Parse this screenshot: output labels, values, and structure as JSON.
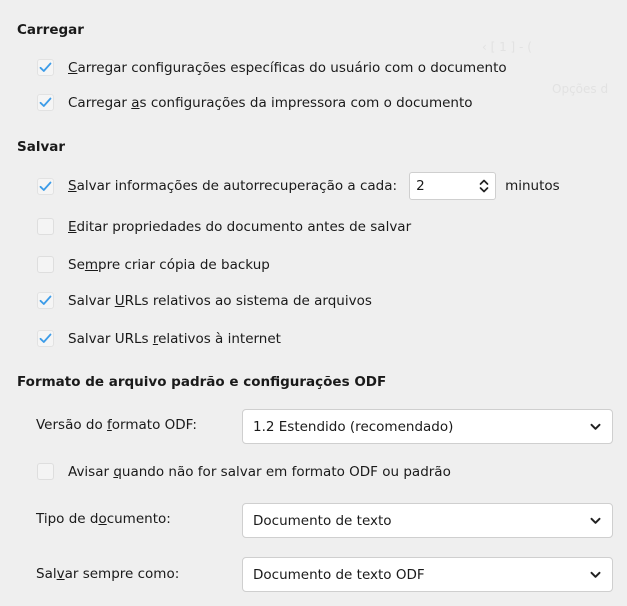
{
  "background_ghost": {
    "line1": "‹  [ 1 ] - (",
    "line2": "Opções d"
  },
  "load": {
    "title": "Carregar",
    "options": [
      {
        "pre": "",
        "key": "C",
        "post": "arregar configurações específicas do usuário com o documento",
        "checked": true
      },
      {
        "pre": "Carregar ",
        "key": "a",
        "post": "s configurações da impressora com o documento",
        "checked": true
      }
    ]
  },
  "save": {
    "title": "Salvar",
    "autosave": {
      "pre": "",
      "key": "S",
      "post": "alvar informações de autorrecuperação a cada:",
      "checked": true,
      "value": "2",
      "unit": "minutos"
    },
    "options": [
      {
        "pre": "",
        "key": "E",
        "post": "ditar propriedades do documento antes de salvar",
        "checked": false
      },
      {
        "pre": "Se",
        "key": "m",
        "post": "pre criar cópia de backup",
        "checked": false
      },
      {
        "pre": "Salvar ",
        "key": "U",
        "post": "RLs relativos ao sistema de arquivos",
        "checked": true
      },
      {
        "pre": "Salvar URLs ",
        "key": "r",
        "post": "elativos à internet",
        "checked": true
      }
    ]
  },
  "odf": {
    "title": "Formato de arquivo padrão e configurações ODF",
    "version": {
      "label_pre": "Versão do ",
      "label_key": "f",
      "label_post": "ormato ODF:",
      "value": "1.2 Estendido (recomendado)"
    },
    "warn": {
      "pre": "Avisar ",
      "key": "q",
      "post": "uando não for salvar em formato ODF ou padrão",
      "checked": false
    },
    "doc_type": {
      "label_pre": "Tipo de d",
      "label_key": "o",
      "label_post": "cumento:",
      "value": "Documento de texto"
    },
    "always_save": {
      "label_pre": "Sal",
      "label_key": "v",
      "label_post": "ar sempre como:",
      "value": "Documento de texto ODF"
    }
  },
  "colors": {
    "check": "#3d9ce8",
    "background": "#efefef"
  }
}
